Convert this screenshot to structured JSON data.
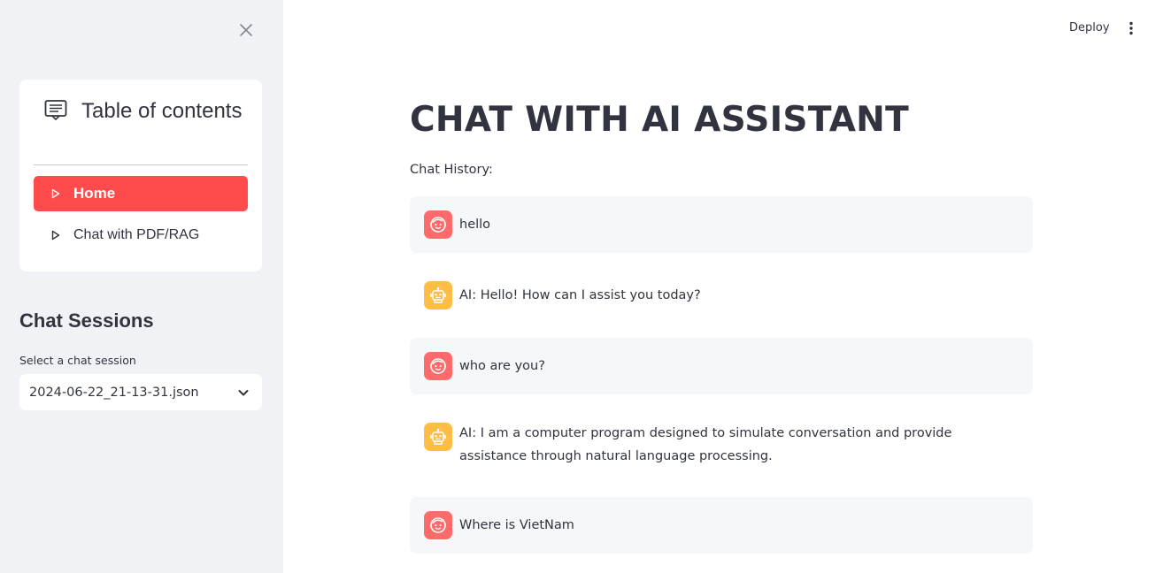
{
  "sidebar": {
    "toc_title": "Table of contents",
    "nav_items": [
      {
        "label": "Home",
        "active": true
      },
      {
        "label": "Chat with PDF/RAG",
        "active": false
      }
    ],
    "sessions_title": "Chat Sessions",
    "select_label": "Select a chat session",
    "selected_session": "2024-06-22_21-13-31.json"
  },
  "header": {
    "deploy_label": "Deploy"
  },
  "main": {
    "title": "CHAT WITH AI ASSISTANT",
    "history_label": "Chat History:",
    "messages": [
      {
        "role": "user",
        "text": "hello"
      },
      {
        "role": "ai",
        "text": "AI: Hello! How can I assist you today?"
      },
      {
        "role": "user",
        "text": "who are you?"
      },
      {
        "role": "ai",
        "text": "AI: I am a computer program designed to simulate conversation and provide assistance through natural language processing."
      },
      {
        "role": "user",
        "text": "Where is VietNam"
      }
    ]
  },
  "colors": {
    "accent": "#ff4b4b",
    "sidebar_bg": "#f0f2f6",
    "user_avatar": "#ff6b6b",
    "ai_avatar": "#ffbd45",
    "message_bg": "#f6f7f9"
  }
}
